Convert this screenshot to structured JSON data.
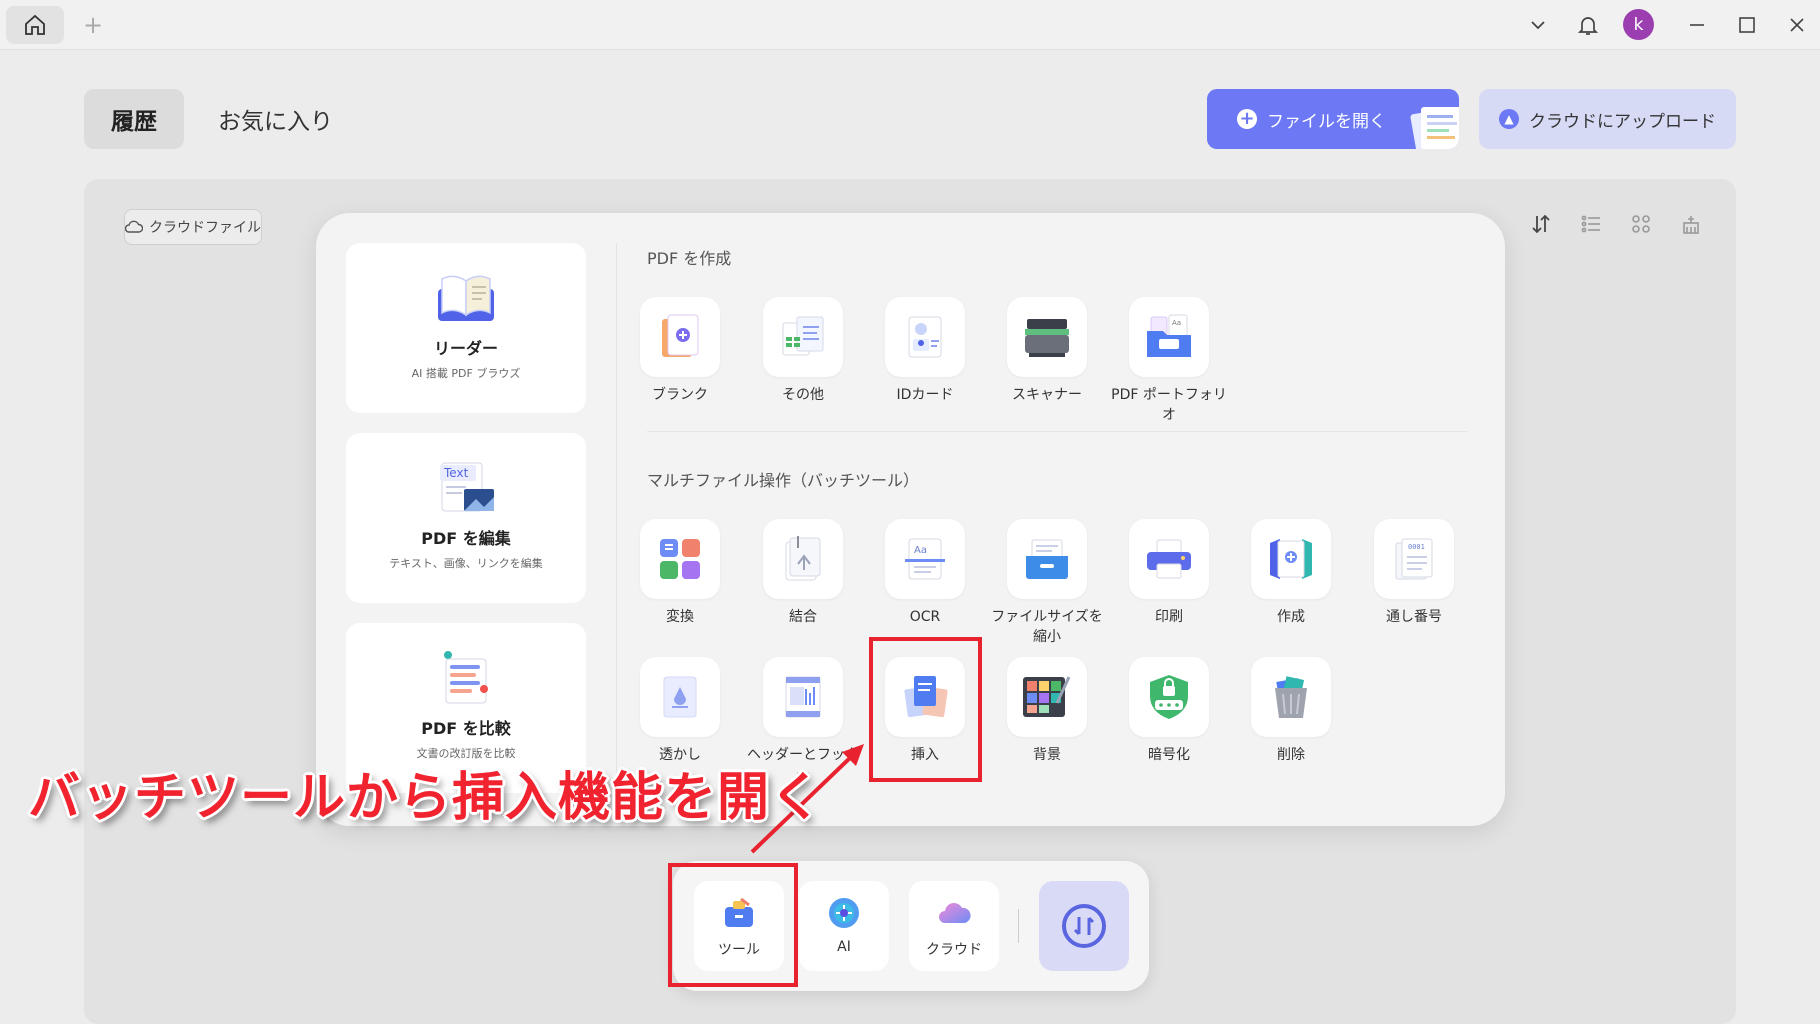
{
  "titlebar": {
    "avatar_initial": "k"
  },
  "header": {
    "tab_history": "履歴",
    "tab_favorites": "お気に入り",
    "open_file": "ファイルを開く",
    "cloud_upload": "クラウドにアップロード"
  },
  "content": {
    "cloud_files": "クラウドファイル"
  },
  "features": [
    {
      "title": "リーダー",
      "subtitle": "AI 搭載 PDF ブラウズ"
    },
    {
      "title": "PDF を編集",
      "subtitle": "テキスト、画像、リンクを編集",
      "badge": "Text"
    },
    {
      "title": "PDF を比較",
      "subtitle": "文書の改訂版を比較"
    }
  ],
  "create_section": {
    "title": "PDF を作成",
    "items": [
      "ブランク",
      "その他",
      "IDカード",
      "スキャナー",
      "PDF ポートフォリオ"
    ]
  },
  "batch_section": {
    "title": "マルチファイル操作（バッチツール）",
    "row1": [
      "変換",
      "結合",
      "OCR",
      "ファイルサイズを縮小",
      "印刷",
      "作成",
      "通し番号"
    ],
    "row2": [
      "透かし",
      "ヘッダーとフッター",
      "挿入",
      "背景",
      "暗号化",
      "削除"
    ]
  },
  "dock": {
    "tools": "ツール",
    "ai": "AI",
    "cloud": "クラウド"
  },
  "annotation": {
    "caption": "バッチツールから挿入機能を開く"
  },
  "colors": {
    "accent": "#6c78f4",
    "highlight": "#e8222f",
    "avatar": "#9b3fb0"
  }
}
